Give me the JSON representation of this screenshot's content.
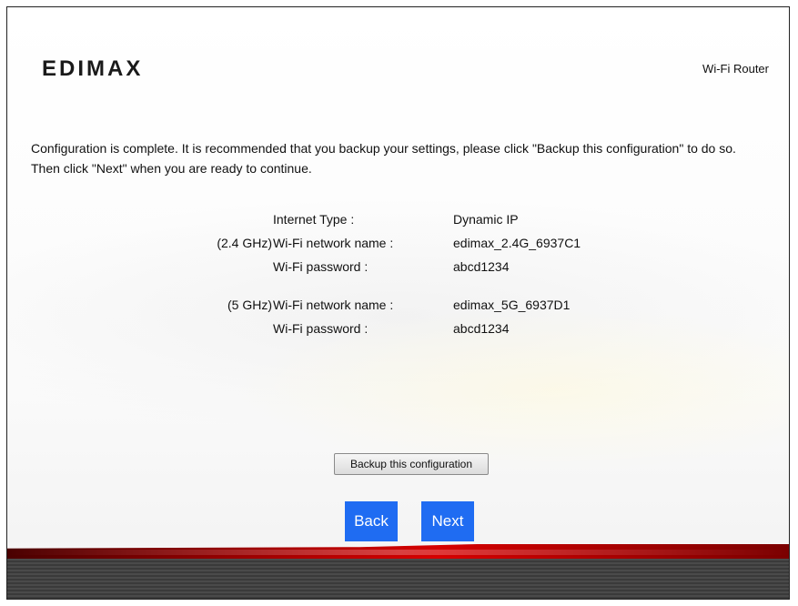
{
  "header": {
    "brand": "EDIMAX",
    "product": "Wi-Fi Router"
  },
  "message": "Configuration is complete. It is recommended that you backup your settings, please click \"Backup this configuration\" to do so. Then click \"Next\" when you are ready to continue.",
  "summary": {
    "internet_type": {
      "label": "Internet Type :",
      "value": "Dynamic IP"
    },
    "band_24": {
      "prefix": "(2.4 GHz)",
      "network_name_label": "Wi-Fi network name :",
      "network_name": "edimax_2.4G_6937C1",
      "password_label": "Wi-Fi password :",
      "password": "abcd1234"
    },
    "band_5": {
      "prefix": "(5 GHz)",
      "network_name_label": "Wi-Fi network name :",
      "network_name": "edimax_5G_6937D1",
      "password_label": "Wi-Fi password :",
      "password": "abcd1234"
    }
  },
  "buttons": {
    "backup": "Backup this configuration",
    "back": "Back",
    "next": "Next"
  },
  "colors": {
    "nav_button": "#1f6cf2",
    "footer_red": "#d60000",
    "footer_dark": "#3a3a3a"
  }
}
